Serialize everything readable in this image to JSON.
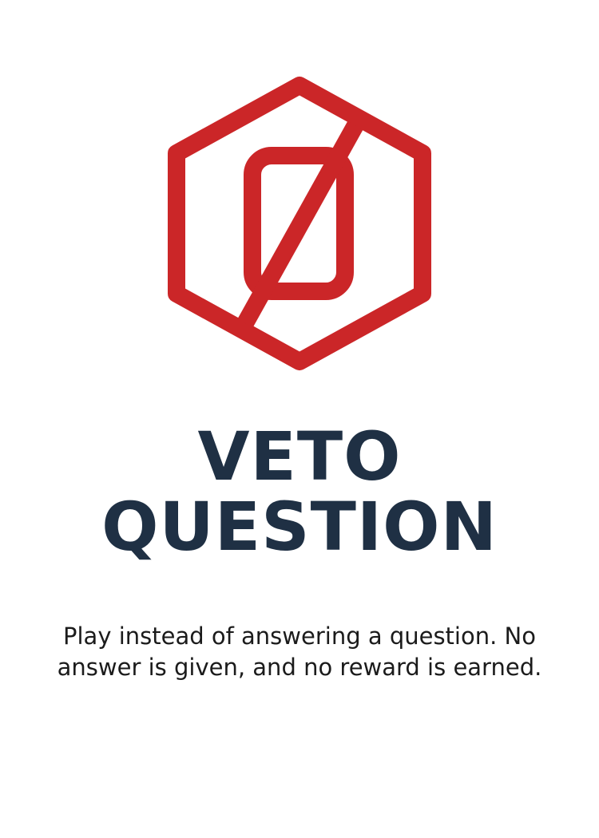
{
  "card": {
    "icon": "veto-hexagon-icon",
    "accent_color": "#cb2628",
    "title_color": "#1f3044",
    "title_line_1": "VETO",
    "title_line_2": "QUESTION",
    "description": "Play instead of answering a question. No answer is given, and no reward is earned."
  }
}
